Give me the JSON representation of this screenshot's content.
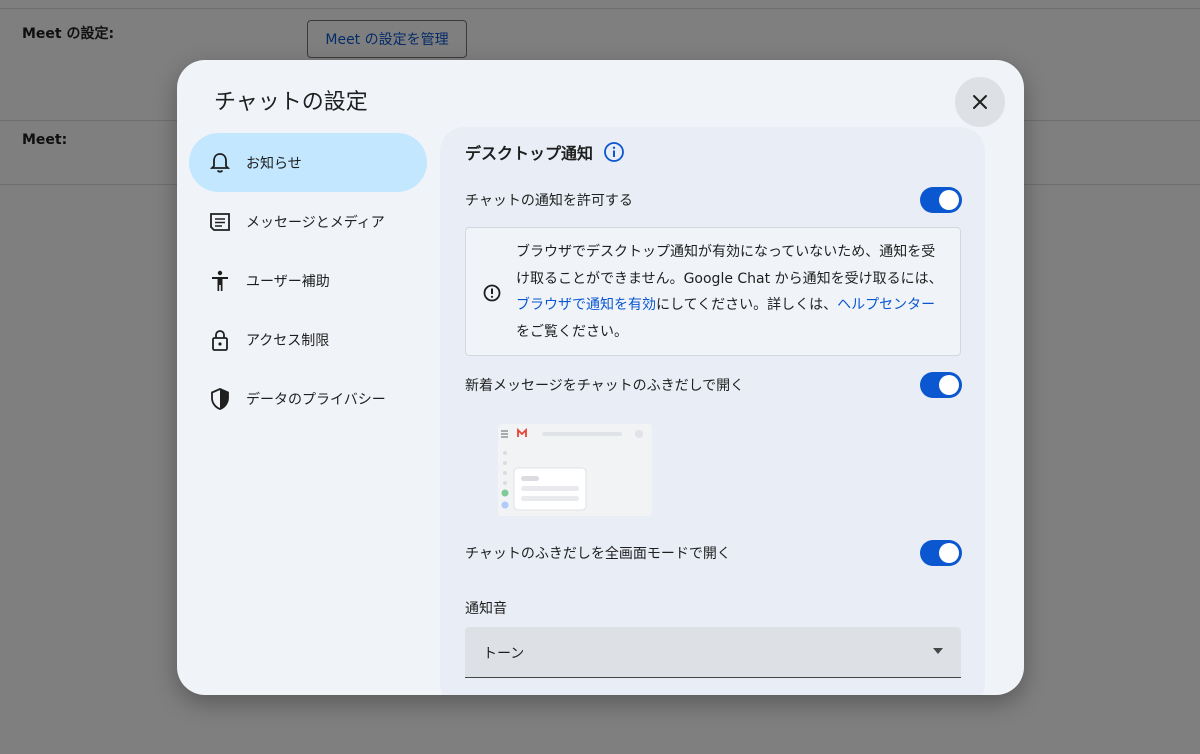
{
  "background": {
    "meet_settings_label": "Meet の設定:",
    "manage_meet_button": "Meet の設定を管理",
    "meet_label": "Meet:"
  },
  "dialog": {
    "title": "チャットの設定",
    "close_icon": "close-icon"
  },
  "sidebar": {
    "items": [
      {
        "label": "お知らせ",
        "icon": "bell-icon",
        "active": true
      },
      {
        "label": "メッセージとメディア",
        "icon": "message-icon",
        "active": false
      },
      {
        "label": "ユーザー補助",
        "icon": "accessibility-icon",
        "active": false
      },
      {
        "label": "アクセス制限",
        "icon": "lock-icon",
        "active": false
      },
      {
        "label": "データのプライバシー",
        "icon": "shield-icon",
        "active": false
      }
    ]
  },
  "content": {
    "section_title": "デスクトップ通知",
    "allow_notifications": {
      "label": "チャットの通知を許可する",
      "enabled": true
    },
    "warning": {
      "text_1": "ブラウザでデスクトップ通知が有効になっていないため、通知を受け取ることができません。Google Chat から通知を受け取るには、",
      "link_1": "ブラウザで通知を有効",
      "text_2": "にしてください。詳しくは、",
      "link_2": "ヘルプセンター",
      "text_3": "をご覧ください。"
    },
    "open_in_bubble": {
      "label": "新着メッセージをチャットのふきだしで開く",
      "enabled": true
    },
    "fullscreen_bubble": {
      "label": "チャットのふきだしを全画面モードで開く",
      "enabled": true
    },
    "notification_sound": {
      "label": "通知音",
      "value": "トーン"
    }
  },
  "colors": {
    "accent": "#0b57d0",
    "active_nav": "#c2e7ff",
    "dialog_bg": "#f0f4f9",
    "panel_bg": "#e9eef6"
  }
}
